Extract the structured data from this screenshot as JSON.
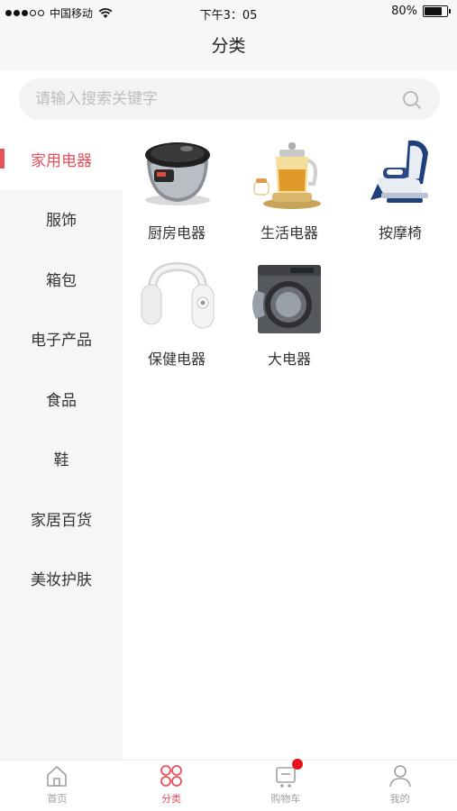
{
  "status_bar": {
    "carrier": "中国移动",
    "time": "下午3：05",
    "battery_percent": "80%",
    "battery_level": 0.8
  },
  "nav": {
    "title": "分类"
  },
  "search": {
    "placeholder": "请输入搜索关键字",
    "value": ""
  },
  "sidebar": {
    "active_index": 0,
    "items": [
      {
        "label": "家用电器"
      },
      {
        "label": "服饰"
      },
      {
        "label": "箱包"
      },
      {
        "label": "电子产品"
      },
      {
        "label": "食品"
      },
      {
        "label": "鞋"
      },
      {
        "label": "家居百货"
      },
      {
        "label": "美妆护肤"
      }
    ]
  },
  "categories": [
    {
      "label": "厨房电器",
      "icon": "rice-cooker-image"
    },
    {
      "label": "生活电器",
      "icon": "health-kettle-image"
    },
    {
      "label": "按摩椅",
      "icon": "massage-chair-image"
    },
    {
      "label": "保健电器",
      "icon": "neck-massager-image"
    },
    {
      "label": "大电器",
      "icon": "washing-machine-image"
    }
  ],
  "tabbar": {
    "active_index": 1,
    "items": [
      {
        "label": "首页",
        "icon": "home-icon"
      },
      {
        "label": "分类",
        "icon": "category-icon"
      },
      {
        "label": "购物车",
        "icon": "cart-icon"
      },
      {
        "label": "我的",
        "icon": "user-icon"
      }
    ]
  },
  "colors": {
    "accent": "#e8505b",
    "badge": "#e5131d",
    "sidebar_bg": "#f6f6f6",
    "tab_inactive": "#a0a0a0"
  }
}
